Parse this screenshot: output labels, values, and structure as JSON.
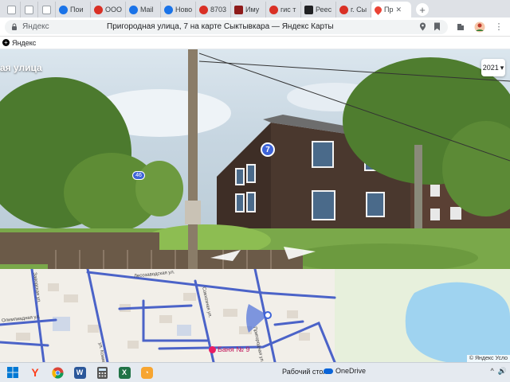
{
  "browser": {
    "tabs": [
      {
        "label": "",
        "icon": "page-icon",
        "pinned": true
      },
      {
        "label": "",
        "icon": "page-icon",
        "pinned": true
      },
      {
        "label": "",
        "icon": "page-icon",
        "pinned": true
      },
      {
        "label": "Пои",
        "icon": "yandex-search-icon"
      },
      {
        "label": "ООО",
        "icon": "pdf-icon"
      },
      {
        "label": "Mail",
        "icon": "mail-icon"
      },
      {
        "label": "Ново",
        "icon": "mail-icon"
      },
      {
        "label": "8703",
        "icon": "pdf-icon"
      },
      {
        "label": "Иму",
        "icon": "cian-icon"
      },
      {
        "label": "гис т",
        "icon": "search-icon"
      },
      {
        "label": "Реес",
        "icon": "rosreestr-icon"
      },
      {
        "label": "г. Сы",
        "icon": "search-icon"
      },
      {
        "label": "Пр",
        "icon": "yandex-maps-icon",
        "active": true
      }
    ],
    "new_tab_label": "+",
    "address": {
      "domain": "Яндекс",
      "title": "Пригородная улица, 7 на карте Сыктывкара — Яндекс Карты"
    },
    "bookmark": {
      "label": "Яндекс"
    }
  },
  "panorama": {
    "street_name": "ая улица",
    "year": "2021",
    "house_number": "7",
    "road_number": "46"
  },
  "map": {
    "labels": [
      {
        "text": "Лесозаводская ул."
      },
      {
        "text": "Пригородная ул."
      },
      {
        "text": "Совхозная ул."
      },
      {
        "text": "Заводская ул."
      },
      {
        "text": "Олимпиадная ул."
      },
      {
        "text": "ул. Коммунистов"
      }
    ],
    "poi": "Баня № 9",
    "attribution": "© Яндекс  Усло"
  },
  "taskbar": {
    "apps": [
      {
        "name": "windows-start-icon",
        "letter": ""
      },
      {
        "name": "yandex-browser-icon",
        "letter": "Y"
      },
      {
        "name": "chrome-icon",
        "letter": ""
      },
      {
        "name": "word-icon",
        "letter": "W"
      },
      {
        "name": "calculator-icon",
        "letter": ""
      },
      {
        "name": "excel-icon",
        "letter": "X"
      },
      {
        "name": "onedrive-app-icon",
        "letter": ""
      }
    ],
    "desktop_label": "Рабочий стол",
    "onedrive_label": "OneDrive",
    "tray": [
      "^",
      "🔊"
    ]
  },
  "colors": {
    "accent": "#3e64d8",
    "tab_strip": "#dee1e6",
    "map_bg": "#f2efe9",
    "road_blue": "#4b63c8"
  }
}
